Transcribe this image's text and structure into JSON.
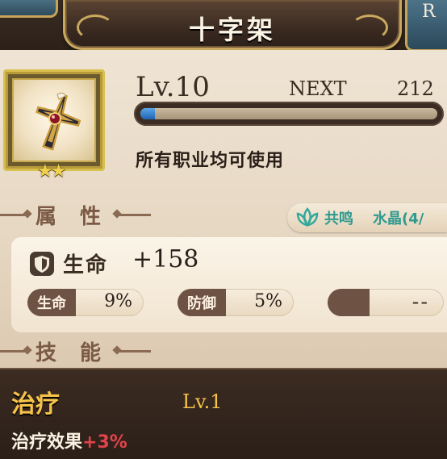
{
  "window": {
    "title": "十字架",
    "corner_letter": "R"
  },
  "item": {
    "icon": "cross-icon",
    "stars": "★★",
    "level": "Lv.10",
    "next_label": "NEXT",
    "next_value": "212",
    "exp_progress": 0.05,
    "usage": "所有职业均可使用"
  },
  "attributes": {
    "section_title": "属 性",
    "resonance_label": "共鸣",
    "crystal_label": "水晶(4/",
    "hp_label": "生命",
    "hp_value": "+158",
    "bonuses": [
      {
        "label": "生命",
        "value": "9%"
      },
      {
        "label": "防御",
        "value": "5%"
      },
      {
        "label": "",
        "value": "--"
      }
    ]
  },
  "skills": {
    "section_title": "技 能",
    "skill_name": "治疗",
    "skill_level": "Lv.1",
    "effect_label": "治疗效果",
    "effect_value": "+3%"
  },
  "colors": {
    "accent_gold": "#f5c24a",
    "resonance_teal": "#2f9a8f",
    "exp_blue": "#1f62b3",
    "effect_red": "#e0434a"
  }
}
